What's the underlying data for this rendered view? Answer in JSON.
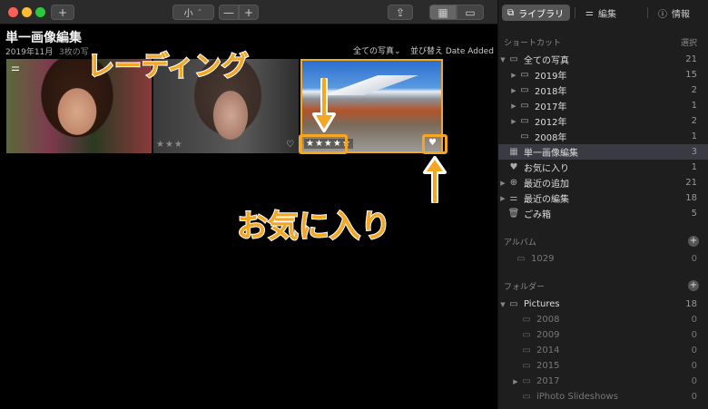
{
  "toolbar": {
    "add_label": "+",
    "size_label": "小",
    "size_chevron": "⌃",
    "zoom_minus": "—",
    "zoom_plus": "+",
    "share_icon": "⇪",
    "grid_icon": "▦",
    "single_icon": "▭"
  },
  "main": {
    "album_title": "単一画像編集",
    "album_date": "2019年11月",
    "photo_count": "3枚の写",
    "filter_label": "全ての写真⌄",
    "sort_label": "並び替え Date Added",
    "photos": [
      {
        "adjust_icon": "⚌"
      },
      {
        "stars": "★★★",
        "heart": "♡"
      },
      {
        "stars": "★★★★★",
        "heart": "♥"
      }
    ]
  },
  "annotations": {
    "rating_label": "レーディング",
    "favorite_label": "お気に入り",
    "accent": "#f5a623"
  },
  "sidebar": {
    "tabs": [
      {
        "icon": "⧉",
        "label": "ライブラリ"
      },
      {
        "icon": "⚌",
        "label": "編集"
      },
      {
        "icon": "ⓘ",
        "label": "情報"
      }
    ],
    "shortcuts_header": "ショートカット",
    "select_label": "選択",
    "items": [
      {
        "disc": "▼",
        "icon": "▭",
        "label": "全ての写真",
        "count": "21"
      },
      {
        "disc": "▶",
        "icon": "▭",
        "label": "2019年",
        "count": "15"
      },
      {
        "disc": "▶",
        "icon": "▭",
        "label": "2018年",
        "count": "2"
      },
      {
        "disc": "▶",
        "icon": "▭",
        "label": "2017年",
        "count": "1"
      },
      {
        "disc": "▶",
        "icon": "▭",
        "label": "2012年",
        "count": "2"
      },
      {
        "disc": "",
        "icon": "▭",
        "label": "2008年",
        "count": "1"
      },
      {
        "disc": "",
        "icon": "▦",
        "label": "単一画像編集",
        "count": "3"
      },
      {
        "disc": "",
        "icon": "♥",
        "label": "お気に入り",
        "count": "1"
      },
      {
        "disc": "▶",
        "icon": "⊕",
        "label": "最近の追加",
        "count": "21"
      },
      {
        "disc": "▶",
        "icon": "⚌",
        "label": "最近の編集",
        "count": "18"
      },
      {
        "disc": "",
        "icon": "🗑",
        "label": "ごみ箱",
        "count": "5"
      }
    ],
    "albums_header": "アルバム",
    "albums_plus": "+",
    "albums": [
      {
        "icon": "▭",
        "label": "1029",
        "count": "0"
      }
    ],
    "folders_header": "フォルダー",
    "folders_plus": "+",
    "folders": [
      {
        "disc": "▼",
        "icon": "▭",
        "label": "Pictures",
        "count": "18"
      },
      {
        "disc": "",
        "icon": "▭",
        "label": "2008",
        "count": "0"
      },
      {
        "disc": "",
        "icon": "▭",
        "label": "2009",
        "count": "0"
      },
      {
        "disc": "",
        "icon": "▭",
        "label": "2014",
        "count": "0"
      },
      {
        "disc": "",
        "icon": "▭",
        "label": "2015",
        "count": "0"
      },
      {
        "disc": "▶",
        "icon": "▭",
        "label": "2017",
        "count": "0"
      },
      {
        "disc": "",
        "icon": "▭",
        "label": "iPhoto Slideshows",
        "count": "0"
      }
    ]
  }
}
